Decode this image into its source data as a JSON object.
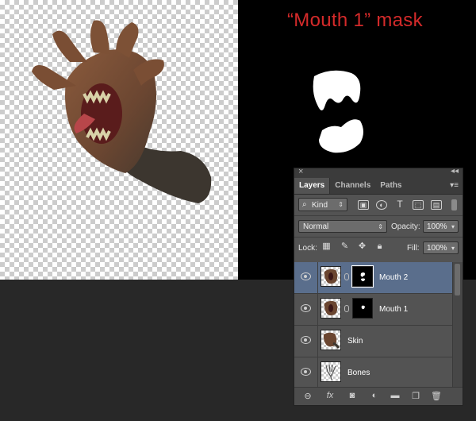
{
  "canvas": {
    "mask_title": "“Mouth 1” mask"
  },
  "layers_panel": {
    "close_glyph": "×",
    "collapse_glyph": "◂◂",
    "tabs": [
      {
        "label": "Layers",
        "active": true
      },
      {
        "label": "Channels",
        "active": false
      },
      {
        "label": "Paths",
        "active": false
      }
    ],
    "menu_glyph": "▾≡",
    "filter": {
      "kind_label": "Kind",
      "icons": [
        "image-filter-icon",
        "adjustment-filter-icon",
        "type-filter-icon",
        "shape-filter-icon",
        "smart-object-filter-icon"
      ]
    },
    "blend_mode": "Normal",
    "opacity_label": "Opacity:",
    "opacity_value": "100%",
    "lock_label": "Lock:",
    "lock_icons": [
      "lock-transparent-icon",
      "lock-pixels-icon",
      "lock-position-icon",
      "lock-all-icon"
    ],
    "fill_label": "Fill:",
    "fill_value": "100%",
    "layers": [
      {
        "name": "Mouth 2",
        "visible": true,
        "selected": true,
        "has_mask": true
      },
      {
        "name": "Mouth 1",
        "visible": true,
        "selected": false,
        "has_mask": true
      },
      {
        "name": "Skin",
        "visible": true,
        "selected": false,
        "has_mask": false
      },
      {
        "name": "Bones",
        "visible": true,
        "selected": false,
        "has_mask": false
      }
    ],
    "footer_buttons": [
      "link-layers-icon",
      "fx-icon",
      "add-mask-icon",
      "adjustment-layer-icon",
      "new-group-icon",
      "new-layer-icon",
      "trash-icon"
    ]
  }
}
